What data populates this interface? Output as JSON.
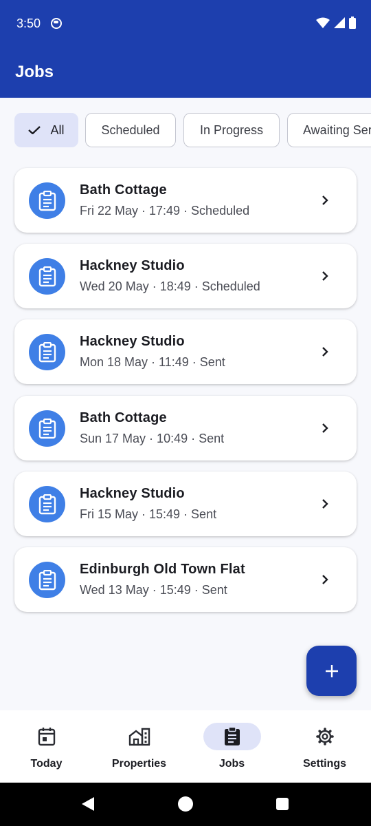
{
  "status_bar": {
    "time": "3:50"
  },
  "app_bar": {
    "title": "Jobs"
  },
  "filters": [
    {
      "label": "All",
      "selected": true
    },
    {
      "label": "Scheduled",
      "selected": false
    },
    {
      "label": "In Progress",
      "selected": false
    },
    {
      "label": "Awaiting Ser",
      "selected": false
    }
  ],
  "jobs": [
    {
      "name": "Bath Cottage",
      "meta": "Fri 22 May · 17:49 · Scheduled",
      "icon": "clipboard-icon"
    },
    {
      "name": "Hackney Studio",
      "meta": "Wed 20 May · 18:49 · Scheduled",
      "icon": "clipboard-icon"
    },
    {
      "name": "Hackney Studio",
      "meta": "Mon 18 May · 11:49 · Sent",
      "icon": "clipboard-icon"
    },
    {
      "name": "Bath Cottage",
      "meta": "Sun 17 May · 10:49 · Sent",
      "icon": "clipboard-icon"
    },
    {
      "name": "Hackney Studio",
      "meta": "Fri 15 May · 15:49 · Sent",
      "icon": "clipboard-icon"
    },
    {
      "name": "Edinburgh Old Town Flat",
      "meta": "Wed 13 May · 15:49 · Sent",
      "icon": "clipboard-icon"
    }
  ],
  "fab": {
    "icon": "plus-icon"
  },
  "bottom_nav": [
    {
      "label": "Today",
      "icon": "calendar-icon",
      "active": false
    },
    {
      "label": "Properties",
      "icon": "buildings-icon",
      "active": false
    },
    {
      "label": "Jobs",
      "icon": "clipboard-icon",
      "active": true
    },
    {
      "label": "Settings",
      "icon": "gear-icon",
      "active": false
    }
  ],
  "colors": {
    "primary": "#1d3fae",
    "avatar": "#3f7fe6",
    "chip_selected": "#dfe3f8",
    "background": "#f7f8fc"
  }
}
